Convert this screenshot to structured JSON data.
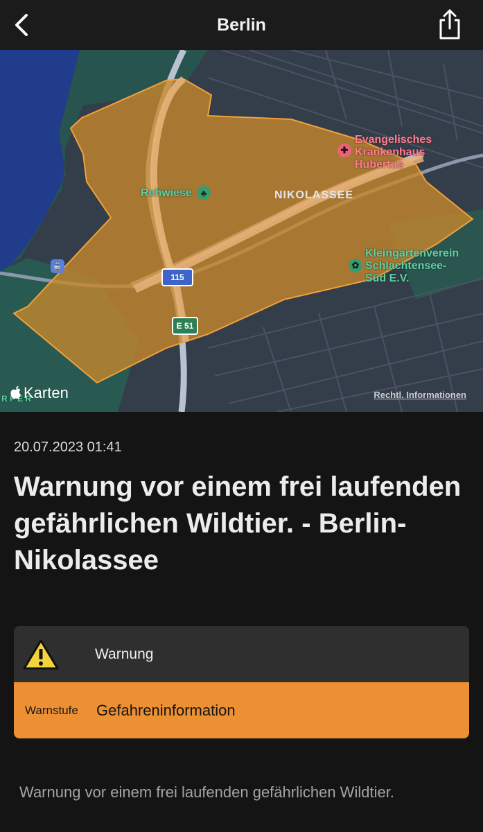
{
  "navbar": {
    "title": "Berlin",
    "back_icon": "chevron-left-icon",
    "share_icon": "share-icon"
  },
  "map": {
    "district_label": "NIKOLASSEE",
    "poi_rehwiese": "Rehwiese",
    "poi_hospital_line1": "Evangelisches",
    "poi_hospital_line2": "Krankenhaus",
    "poi_hospital_line3": "Hubertus",
    "poi_garden_line1": "Kleingartenverein",
    "poi_garden_line2": "Schlachtensee-",
    "poi_garden_line3": "Süd E.V.",
    "road_shield_a": "115",
    "road_shield_b": "E 51",
    "edge_label": "R P E R",
    "maps_brand": "Karten",
    "legal_link": "Rechtl. Informationen",
    "colors": {
      "warning_area_fill": "#c9882a",
      "warning_area_border": "#f0a23a"
    }
  },
  "alert": {
    "timestamp": "20.07.2023 01:41",
    "headline": "Warnung vor einem frei laufenden gefährlichen Wildtier. - Berlin-Nikolassee",
    "type_label": "Warnung",
    "level_label": "Warnstufe",
    "level_value": "Gefahreninformation",
    "description": "Warnung vor einem frei laufenden gefährlichen Wildtier.",
    "colors": {
      "level_band": "#ec9033",
      "warning_icon": "#f5d33a"
    }
  }
}
